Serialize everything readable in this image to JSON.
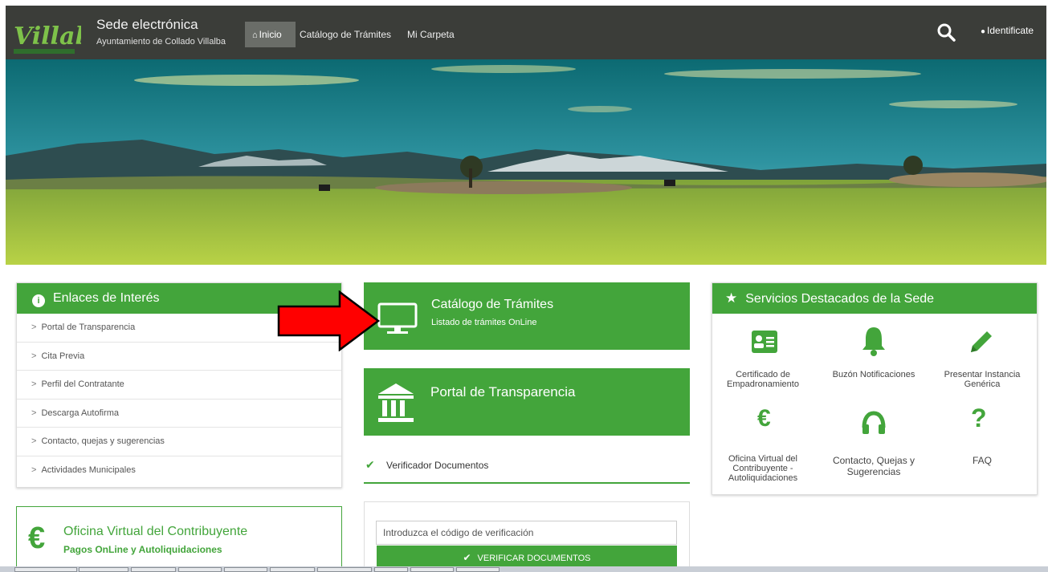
{
  "navbar": {
    "logo_text": "Villalba",
    "title": "Sede electrónica",
    "subtitle": "Ayuntamiento de Collado Villalba",
    "nav_items": [
      {
        "label": "Inicio"
      },
      {
        "label": "Catálogo de Trámites"
      },
      {
        "label": "Mi Carpeta"
      }
    ],
    "login_label": "Identificate"
  },
  "enlaces": {
    "title": "Enlaces de Interés",
    "items": [
      {
        "label": "Portal de Transparencia"
      },
      {
        "label": "Cita Previa"
      },
      {
        "label": "Perfil del Contratante"
      },
      {
        "label": "Descarga Autofirma"
      },
      {
        "label": "Contacto, quejas y sugerencias"
      },
      {
        "label": "Actividades Municipales"
      }
    ]
  },
  "contribuyente": {
    "title": "Oficina Virtual del Contribuyente",
    "subtitle": "Pagos OnLine y Autoliquidaciones"
  },
  "tramites_card": {
    "title": "Catálogo de Trámites",
    "subtitle": "Listado de trámites OnLine"
  },
  "portal_card": {
    "title": "Portal de Transparencia"
  },
  "verificador": {
    "label": "Verificador Documentos",
    "placeholder": "Introduzca el código de verificación",
    "button_label": "VERIFICAR DOCUMENTOS"
  },
  "servicios": {
    "title": "Servicios Destacados de la Sede",
    "items": [
      {
        "label": "Certificado de Empadronamiento",
        "icon": "id-card-icon"
      },
      {
        "label": "Buzón Notificaciones",
        "icon": "bell-icon"
      },
      {
        "label": "Presentar Instancia Genérica",
        "icon": "pencil-icon"
      },
      {
        "label": "Oficina Virtual del Contribuyente - Autoliquidaciones",
        "icon": "euro-icon"
      },
      {
        "label": "Contacto, Quejas y Sugerencias",
        "icon": "headphones-icon"
      },
      {
        "label": "FAQ",
        "icon": "question-icon"
      }
    ]
  },
  "colors": {
    "accent": "#43a53b",
    "navbar": "#3b3d39",
    "annotation_arrow": "#ff0000"
  }
}
